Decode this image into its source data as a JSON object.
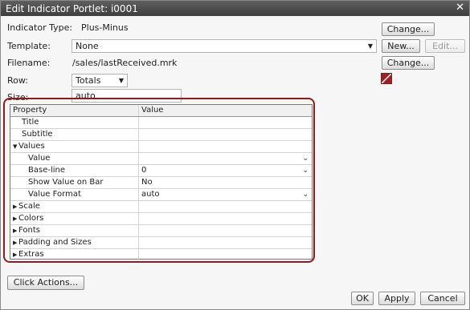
{
  "window": {
    "title": "Edit Indicator Portlet: i0001",
    "close_glyph": "✕"
  },
  "form": {
    "indicator_type_label": "Indicator Type:",
    "indicator_type_value": "Plus-Minus",
    "template_label": "Template:",
    "template_value": "None",
    "filename_label": "Filename:",
    "filename_value": "/sales/lastReceived.mrk",
    "row_label": "Row:",
    "row_value": "Totals",
    "size_label": "Size:",
    "size_value": "auto"
  },
  "buttons": {
    "change1": "Change...",
    "new": "New...",
    "edit": "Edit...",
    "change2": "Change...",
    "click_actions": "Click Actions...",
    "ok": "OK",
    "apply": "Apply",
    "cancel": "Cancel"
  },
  "colors": {
    "swatch": "#a01e24",
    "frame": "#8b1d1d"
  },
  "property_table": {
    "headers": {
      "property": "Property",
      "value": "Value"
    },
    "rows": [
      {
        "name": "Title",
        "value": ""
      },
      {
        "name": "Subtitle",
        "value": ""
      },
      {
        "name": "Values",
        "value": ""
      },
      {
        "name": "Value",
        "value": ""
      },
      {
        "name": "Base-line",
        "value": "0"
      },
      {
        "name": "Show Value on Bar",
        "value": "No"
      },
      {
        "name": "Value Format",
        "value": "auto"
      },
      {
        "name": "Scale",
        "value": ""
      },
      {
        "name": "Colors",
        "value": ""
      },
      {
        "name": "Fonts",
        "value": ""
      },
      {
        "name": "Padding and Sizes",
        "value": ""
      },
      {
        "name": "Extras",
        "value": ""
      }
    ]
  }
}
